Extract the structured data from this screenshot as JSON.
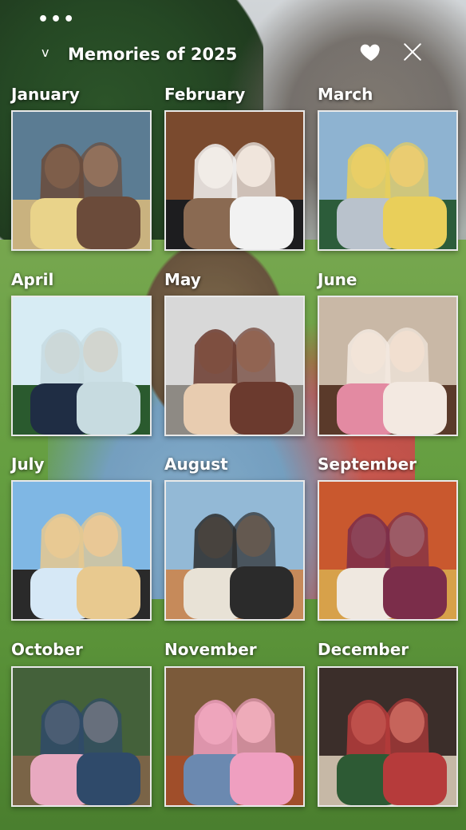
{
  "header": {
    "title": "Memories of 2025",
    "more_glyph": "•••",
    "chevron_glyph": "v",
    "icons": [
      "more-icon",
      "chevron-down-icon",
      "heart-icon",
      "close-icon"
    ]
  },
  "months": [
    {
      "label": "January"
    },
    {
      "label": "February"
    },
    {
      "label": "March"
    },
    {
      "label": "April"
    },
    {
      "label": "May"
    },
    {
      "label": "June"
    },
    {
      "label": "July"
    },
    {
      "label": "August"
    },
    {
      "label": "September"
    },
    {
      "label": "October"
    },
    {
      "label": "November"
    },
    {
      "label": "December"
    }
  ],
  "colors": {
    "text": "#ffffff",
    "frame": "#e9e9e9",
    "grass": "#5e9a37"
  }
}
